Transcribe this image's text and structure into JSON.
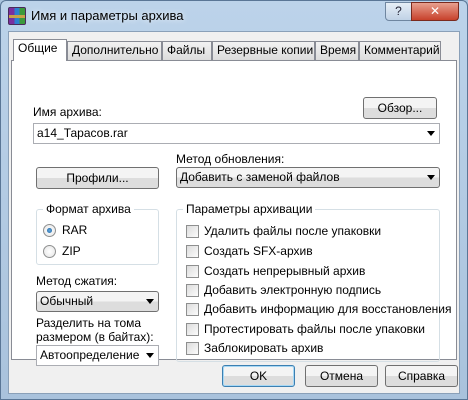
{
  "window": {
    "title": "Имя и параметры архива",
    "help_label": "?",
    "close_label": "✕",
    "app_icon": "winrar-icon"
  },
  "tabs": [
    "Общие",
    "Дополнительно",
    "Файлы",
    "Резервные копии",
    "Время",
    "Комментарий"
  ],
  "active_tab": "Общие",
  "archive_name": {
    "label": "Имя архива:",
    "value": "a14_Тарасов.rar",
    "browse_label": "Обзор..."
  },
  "update_method": {
    "label": "Метод обновления:",
    "value": "Добавить с заменой файлов"
  },
  "profiles_label": "Профили...",
  "archive_format": {
    "title": "Формат архива",
    "options": [
      "RAR",
      "ZIP"
    ],
    "selected": "RAR"
  },
  "compression": {
    "label": "Метод сжатия:",
    "value": "Обычный"
  },
  "split": {
    "label_line1": "Разделить на тома",
    "label_line2": "размером (в байтах):",
    "value": "Автоопределение"
  },
  "archiving_options": {
    "title": "Параметры архивации",
    "items": [
      {
        "label": "Удалить файлы после упаковки",
        "checked": false
      },
      {
        "label": "Создать SFX-архив",
        "checked": false
      },
      {
        "label": "Создать непрерывный архив",
        "checked": false
      },
      {
        "label": "Добавить электронную подпись",
        "checked": false
      },
      {
        "label": "Добавить информацию для восстановления",
        "checked": false
      },
      {
        "label": "Протестировать файлы после упаковки",
        "checked": false
      },
      {
        "label": "Заблокировать архив",
        "checked": false
      }
    ]
  },
  "buttons": {
    "ok": "OK",
    "cancel": "Отмена",
    "help": "Справка"
  }
}
